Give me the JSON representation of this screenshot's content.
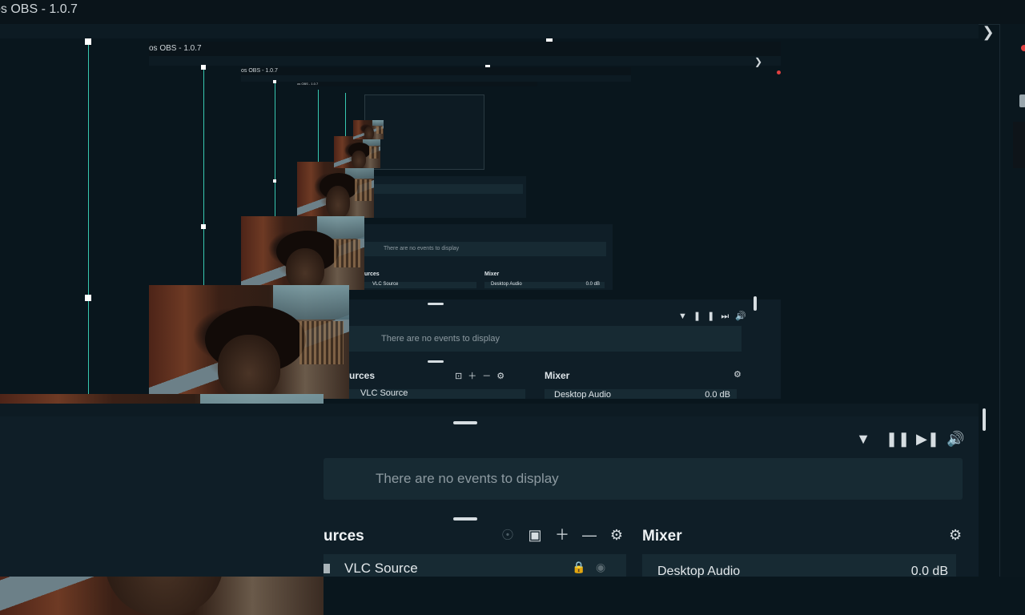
{
  "window": {
    "title": "os OBS - 1.0.7"
  },
  "events": {
    "empty_text": "There are no events to display",
    "icons": [
      "filter-icon",
      "pause-icon",
      "skip-icon",
      "volume-icon"
    ]
  },
  "sources": {
    "heading": "urces",
    "icons": [
      "visibility-toggle-icon",
      "folder-add-icon",
      "plus-icon",
      "minus-icon",
      "gear-icon"
    ],
    "items": [
      {
        "name": "VLC Source"
      }
    ]
  },
  "mixer": {
    "heading": "Mixer",
    "items": [
      {
        "name": "Desktop Audio",
        "level": "0.0 dB"
      }
    ]
  },
  "colors": {
    "guide_line": "#37c8b1",
    "background": "#09161d",
    "panel": "#0f1e27",
    "event_box": "#172a33"
  }
}
